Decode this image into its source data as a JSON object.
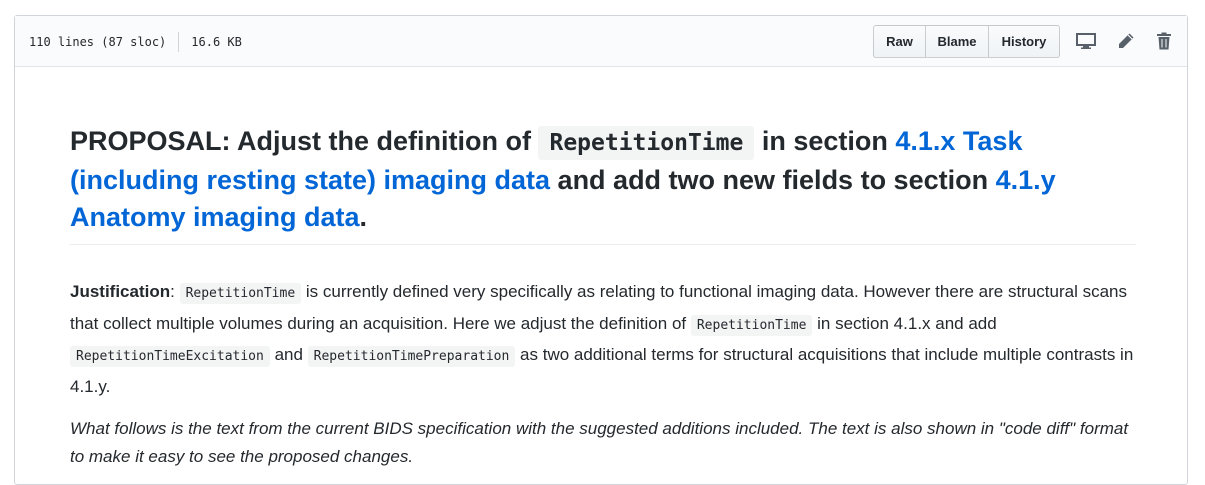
{
  "file_header": {
    "lines": "110 lines (87 sloc)",
    "size": "16.6 KB",
    "buttons": {
      "raw": "Raw",
      "blame": "Blame",
      "history": "History"
    }
  },
  "doc": {
    "heading": {
      "prefix": "PROPOSAL: Adjust the definition of ",
      "code": "RepetitionTime",
      "middle1": " in section ",
      "link1": "4.1.x Task (including resting state) imaging data",
      "middle2": " and add two new fields to section ",
      "link2": "4.1.y Anatomy imaging data",
      "suffix": "."
    },
    "justification": {
      "label": "Justification",
      "colon": ": ",
      "code1": "RepetitionTime",
      "text1": " is currently defined very specifically as relating to functional imaging data. However there are structural scans that collect multiple volumes during an acquisition. Here we adjust the definition of ",
      "code2": "RepetitionTime",
      "text2": " in section 4.1.x and add ",
      "code3": "RepetitionTimeExcitation",
      "text3": " and ",
      "code4": "RepetitionTimePreparation",
      "text4": " as two additional terms for structural acquisitions that include multiple contrasts in 4.1.y."
    },
    "note": "What follows is the text from the current BIDS specification with the suggested additions included. The text is also shown in \"code diff\" format to make it easy to see the proposed changes."
  },
  "icons": [
    "desktop-icon",
    "pencil-icon",
    "trash-icon"
  ]
}
